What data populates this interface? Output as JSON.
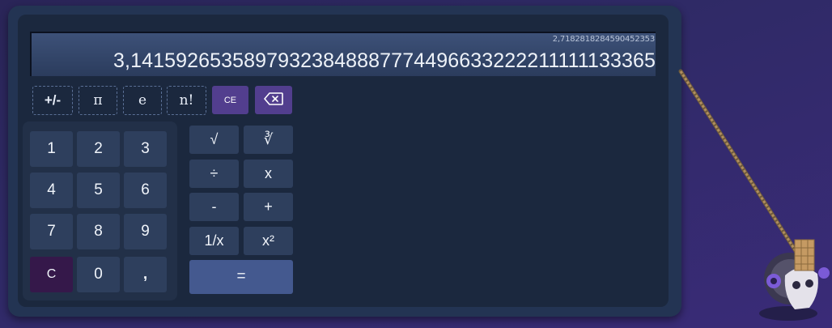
{
  "display": {
    "memory": "2,7182818284590452353",
    "value": "3,14159265358979323848887774496633222211111133365"
  },
  "function_row": {
    "sign": "+/-",
    "pi": "π",
    "e": "e",
    "factorial": "n!",
    "clear_entry": "CE",
    "backspace_icon": "backspace-icon"
  },
  "numpad": {
    "k1": "1",
    "k2": "2",
    "k3": "3",
    "k4": "4",
    "k5": "5",
    "k6": "6",
    "k7": "7",
    "k8": "8",
    "k9": "9",
    "clear": "C",
    "k0": "0",
    "comma": ","
  },
  "operators": {
    "sqrt": "√",
    "cbrt": "∛",
    "divide": "÷",
    "multiply": "x",
    "minus": "-",
    "plus": "+",
    "reciprocal": "1/x",
    "square": "x²",
    "equals": "="
  },
  "colors": {
    "accent_purple": "#523e8e",
    "equals_blue": "#44598f",
    "clear_dark": "#35184a"
  }
}
